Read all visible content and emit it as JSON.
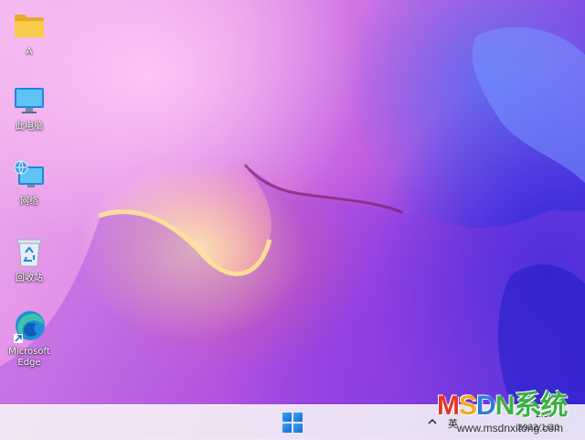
{
  "desktop": {
    "icons": [
      {
        "label": "A",
        "icon": "folder-icon"
      },
      {
        "label": "此电脑",
        "icon": "computer-icon"
      },
      {
        "label": "网络",
        "icon": "network-icon"
      },
      {
        "label": "回收站",
        "icon": "recycle-bin-icon"
      },
      {
        "label": "Microsoft Edge",
        "icon": "edge-icon"
      }
    ]
  },
  "taskbar": {
    "start_icon": "windows-logo-icon",
    "tray_chevron_icon": "chevron-up-icon",
    "input_indicator": "英",
    "time": "2:53",
    "date": "2022/1/20"
  },
  "watermark": {
    "text": "MSDN系统",
    "url": "www.msdnxitong.com",
    "colors": {
      "M": "#e8352b",
      "S": "#f4a81d",
      "D": "#2a7de1",
      "N": "#3cb043",
      "cjk": "#3cb043"
    }
  },
  "colors": {
    "taskbar_bg": "#f3eef6",
    "accent": "#1a73e8"
  }
}
